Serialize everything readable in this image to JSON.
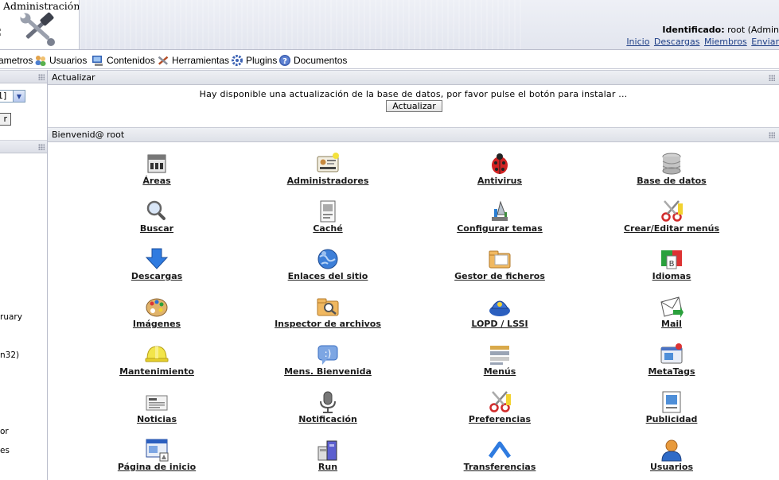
{
  "header": {
    "app_title": "Administración",
    "identified_label": "Identificado:",
    "identified_user": " root (Admin",
    "links": [
      "Inicio",
      "Descargas",
      "Miembros",
      "Enviar"
    ]
  },
  "menu": [
    {
      "label": "ametros",
      "icon": "parameters-icon"
    },
    {
      "label": "Usuarios",
      "icon": "users-icon"
    },
    {
      "label": "Contenidos",
      "icon": "contents-icon"
    },
    {
      "label": "Herramientas",
      "icon": "tools-icon"
    },
    {
      "label": "Plugins",
      "icon": "plugins-icon"
    },
    {
      "label": "Documentos",
      "icon": "help-icon"
    }
  ],
  "left_panel": {
    "select_value": "1]",
    "button_fragment": "r",
    "fragments": [
      "ruary",
      "n32)",
      "or",
      "es"
    ]
  },
  "update_panel": {
    "title": "Actualizar",
    "message": "Hay disponible una actualización de la base de datos, por favor pulse el botón para instalar ...",
    "button": "Actualizar"
  },
  "welcome_panel": {
    "title": "Bienvenid@ root"
  },
  "grid_items": [
    {
      "label": "Áreas",
      "icon": "areas-icon"
    },
    {
      "label": "Administradores",
      "icon": "administrators-icon"
    },
    {
      "label": "Antivirus",
      "icon": "antivirus-icon"
    },
    {
      "label": "Base de datos",
      "icon": "database-icon"
    },
    {
      "label": "Buscar",
      "icon": "search-icon"
    },
    {
      "label": "Caché",
      "icon": "cache-icon"
    },
    {
      "label": "Configurar temas",
      "icon": "themes-icon"
    },
    {
      "label": "Crear/Editar menús",
      "icon": "edit-menus-icon"
    },
    {
      "label": "Descargas",
      "icon": "downloads-icon"
    },
    {
      "label": "Enlaces del sitio",
      "icon": "site-links-icon"
    },
    {
      "label": "Gestor de ficheros",
      "icon": "file-manager-icon"
    },
    {
      "label": "Idiomas",
      "icon": "languages-icon"
    },
    {
      "label": "Imágenes",
      "icon": "images-icon"
    },
    {
      "label": "Inspector de archivos",
      "icon": "file-inspector-icon"
    },
    {
      "label": "LOPD / LSSI",
      "icon": "lopd-icon"
    },
    {
      "label": "Mail",
      "icon": "mail-icon"
    },
    {
      "label": "Mantenimiento",
      "icon": "maintenance-icon"
    },
    {
      "label": "Mens. Bienvenida",
      "icon": "welcome-message-icon"
    },
    {
      "label": "Menús",
      "icon": "menus-icon"
    },
    {
      "label": "MetaTags",
      "icon": "metatags-icon"
    },
    {
      "label": "Noticias",
      "icon": "news-icon"
    },
    {
      "label": "Notificación",
      "icon": "notification-icon"
    },
    {
      "label": "Preferencias",
      "icon": "preferences-icon"
    },
    {
      "label": "Publicidad",
      "icon": "advertising-icon"
    },
    {
      "label": "Página de inicio",
      "icon": "homepage-icon"
    },
    {
      "label": "Run",
      "icon": "run-icon"
    },
    {
      "label": "Transferencias",
      "icon": "transfers-icon"
    },
    {
      "label": "Usuarios",
      "icon": "users-icon"
    }
  ]
}
